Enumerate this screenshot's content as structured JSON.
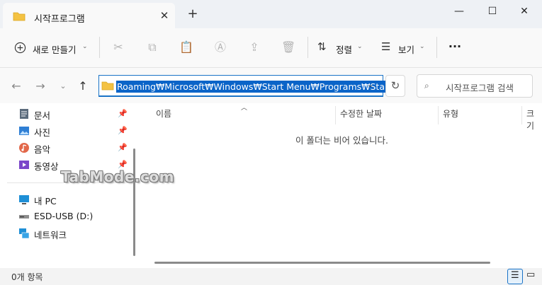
{
  "tab": {
    "title": "시작프로그램",
    "close": "✕",
    "new_tab": "+"
  },
  "window_controls": {
    "minimize": "—",
    "maximize": "☐",
    "close": "✕"
  },
  "toolbar": {
    "new_label": "새로 만들기",
    "sort_label": "정렬",
    "view_label": "보기",
    "more": "···"
  },
  "address": {
    "path": "Roaming₩Microsoft₩Windows₩Start Menu₩Programs₩Startup"
  },
  "search": {
    "placeholder": "시작프로그램 검색"
  },
  "sidebar": {
    "quick": [
      {
        "label": "문서",
        "icon": "documents-icon"
      },
      {
        "label": "사진",
        "icon": "pictures-icon"
      },
      {
        "label": "음악",
        "icon": "music-icon"
      },
      {
        "label": "동영상",
        "icon": "videos-icon"
      }
    ],
    "devices": [
      {
        "label": "내 PC",
        "icon": "this-pc-icon"
      },
      {
        "label": "ESD-USB (D:)",
        "icon": "usb-drive-icon"
      },
      {
        "label": "네트워크",
        "icon": "network-icon"
      }
    ]
  },
  "columns": [
    "이름",
    "수정한 날짜",
    "유형",
    "크기"
  ],
  "empty_message": "이 폴더는 비어 있습니다.",
  "status": {
    "item_count": "0개 항목"
  },
  "watermark": "TabMode.com",
  "colors": {
    "accent": "#0a64c8",
    "folder": "#f4c242"
  }
}
